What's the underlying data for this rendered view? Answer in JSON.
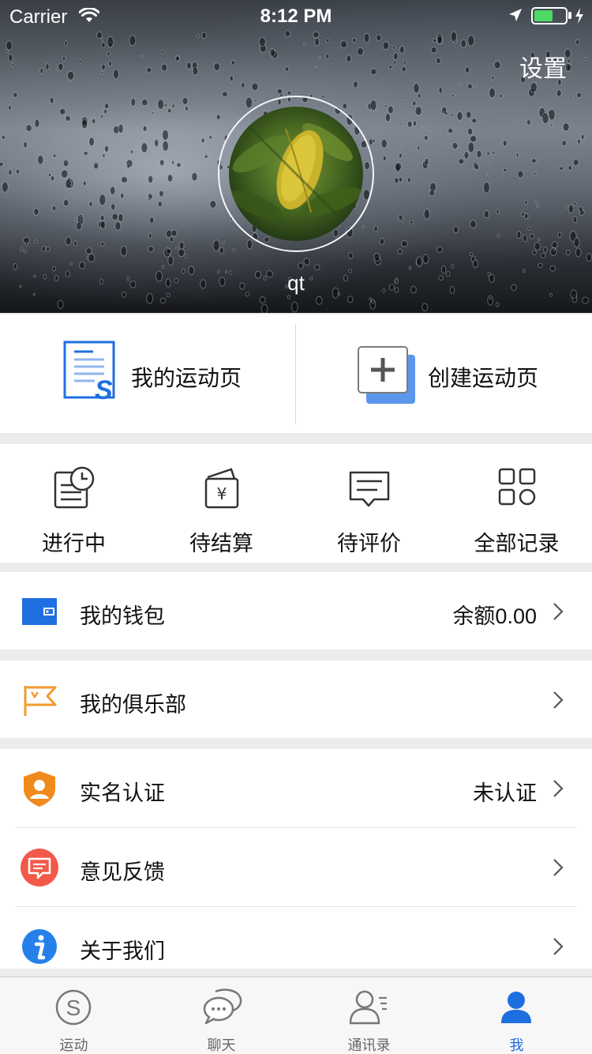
{
  "status_bar": {
    "carrier": "Carrier",
    "time": "8:12 PM",
    "battery_level": 0.6,
    "icons": [
      "wifi-icon",
      "location-arrow-icon",
      "battery-icon",
      "charging-bolt-icon"
    ]
  },
  "header": {
    "settings_label": "设置",
    "username": "qt",
    "avatar": "leaf-photo"
  },
  "quick_cards": [
    {
      "label": "我的运动页",
      "icon": "document-s-icon"
    },
    {
      "label": "创建运动页",
      "icon": "add-page-icon"
    }
  ],
  "orders": [
    {
      "label": "进行中",
      "icon": "clock-document-icon"
    },
    {
      "label": "待结算",
      "icon": "wallet-yuan-icon"
    },
    {
      "label": "待评价",
      "icon": "comment-icon"
    },
    {
      "label": "全部记录",
      "icon": "grid-icon"
    }
  ],
  "menu": {
    "wallet": {
      "label": "我的钱包",
      "value": "余额0.00",
      "icon": "wallet-icon"
    },
    "club": {
      "label": "我的俱乐部",
      "value": "",
      "icon": "flag-icon"
    },
    "verify": {
      "label": "实名认证",
      "value": "未认证",
      "icon": "shield-user-icon"
    },
    "feedback": {
      "label": "意见反馈",
      "value": "",
      "icon": "message-icon"
    },
    "about": {
      "label": "关于我们",
      "value": "",
      "icon": "info-icon"
    }
  },
  "tabs": [
    {
      "label": "运动",
      "icon": "sport-s-icon"
    },
    {
      "label": "聊天",
      "icon": "chat-bubbles-icon"
    },
    {
      "label": "通讯录",
      "icon": "contacts-icon"
    },
    {
      "label": "我",
      "icon": "person-icon",
      "active": true
    }
  ],
  "colors": {
    "accent": "#1d6ee0",
    "wallet": "#1f6fe2",
    "club": "#f29a2e",
    "verify": "#f08a1c",
    "feedback": "#f15a4a",
    "about": "#2680ea"
  }
}
